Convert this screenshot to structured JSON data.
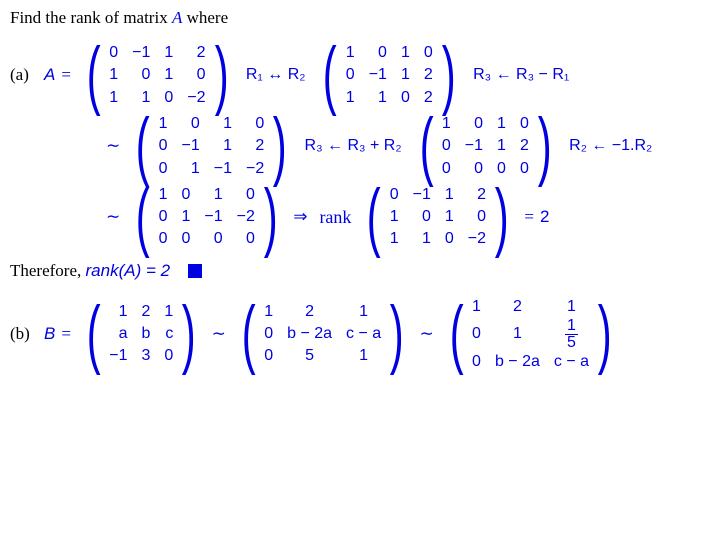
{
  "problem_intro": "Find the rank of matrix ",
  "varA": "A",
  "intro_suffix": " where",
  "partA": {
    "label": "(a) ",
    "lhs": "A",
    "eq": "=",
    "matrix1": [
      [
        "0",
        "−1",
        "1",
        "2"
      ],
      [
        "1",
        "0",
        "1",
        "0"
      ],
      [
        "1",
        "1",
        "0",
        "−2"
      ]
    ],
    "op1": "R₁ ↔ R₂",
    "matrix2": [
      [
        "1",
        "0",
        "1",
        "0"
      ],
      [
        "0",
        "−1",
        "1",
        "2"
      ],
      [
        "1",
        "1",
        "0",
        "2"
      ]
    ],
    "op2": "R₃ ← R₃ − R₁",
    "sim": "∼",
    "matrix3": [
      [
        "1",
        "0",
        "1",
        "0"
      ],
      [
        "0",
        "−1",
        "1",
        "2"
      ],
      [
        "0",
        "1",
        "−1",
        "−2"
      ]
    ],
    "op3": "R₃ ← R₃ + R₂",
    "matrix4": [
      [
        "1",
        "0",
        "1",
        "0"
      ],
      [
        "0",
        "−1",
        "1",
        "2"
      ],
      [
        "0",
        "0",
        "0",
        "0"
      ]
    ],
    "op4": "R₂ ← −1.R₂",
    "matrix5": [
      [
        "1",
        "0",
        "1",
        "0"
      ],
      [
        "0",
        "1",
        "−1",
        "−2"
      ],
      [
        "0",
        "0",
        "0",
        "0"
      ]
    ],
    "implies": "⇒",
    "rank_word": "rank",
    "matrix_orig": [
      [
        "0",
        "−1",
        "1",
        "2"
      ],
      [
        "1",
        "0",
        "1",
        "0"
      ],
      [
        "1",
        "1",
        "0",
        "−2"
      ]
    ],
    "eq2": "=",
    "result": "2",
    "conclusion_prefix": "Therefore, ",
    "conclusion": "rank(A) = 2"
  },
  "partB": {
    "label": "(b) ",
    "lhs": "B",
    "eq": "=",
    "matrix1": [
      [
        "1",
        "2",
        "1"
      ],
      [
        "a",
        "b",
        "c"
      ],
      [
        "−1",
        "3",
        "0"
      ]
    ],
    "sim": "∼",
    "matrix2": [
      [
        "1",
        "2",
        "1"
      ],
      [
        "0",
        "b − 2a",
        "c − a"
      ],
      [
        "0",
        "5",
        "1"
      ]
    ],
    "matrix3_r1": [
      "1",
      "2",
      "1"
    ],
    "matrix3_r2_c1": "0",
    "matrix3_r2_c2": "1",
    "matrix3_r2_c3_num": "1",
    "matrix3_r2_c3_den": "5",
    "matrix3_r3": [
      "0",
      "b − 2a",
      "c − a"
    ]
  }
}
